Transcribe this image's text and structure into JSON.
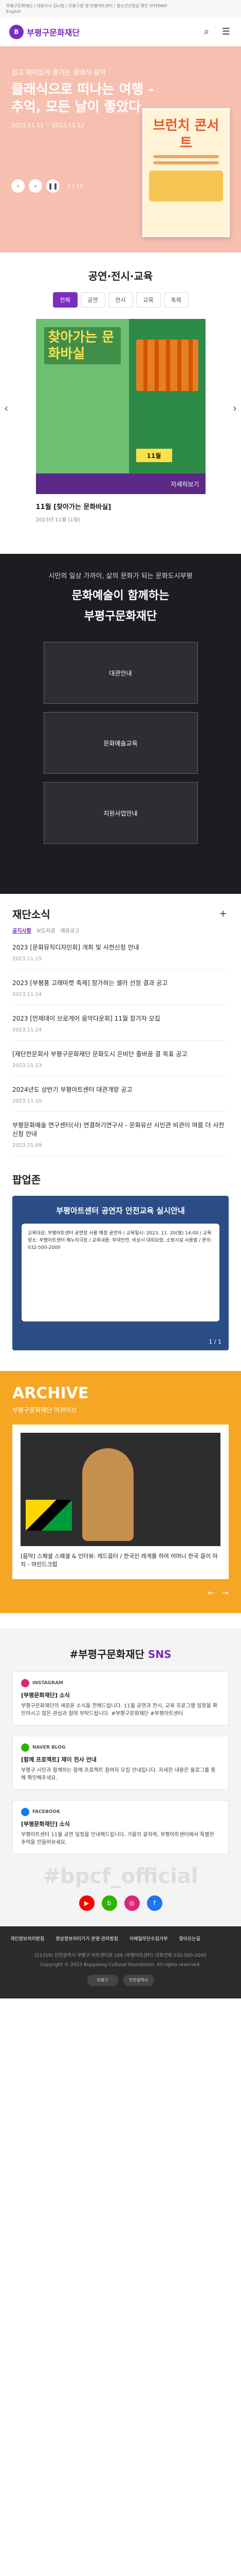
{
  "topbar": {
    "line1": "부평구문화재단 | 대표이사 김나정 | 부평구청 옆 부평아트센터 / 청소년선정성 확인 SITEMAP",
    "line2": "English"
  },
  "header": {
    "logo_text": "부평구문화재단",
    "logo_mark": "B"
  },
  "hero": {
    "sub": "쉽고 재미있게 즐기는 클래식 음악",
    "title": "클래식으로 떠나는 여행 - 추억, 모든 날이 좋았다",
    "date": "2023.11.11 ~ 2023.11.12",
    "counter": "3 / 10",
    "poster_title": "브런치 콘서트"
  },
  "edu": {
    "title": "공연·전시·교육",
    "tabs": [
      "전체",
      "공연",
      "전시",
      "교육",
      "축제"
    ],
    "active_tab": 0,
    "img_big": "찾아가는 문화바실",
    "img_month": "11월",
    "caption": "자세히보기",
    "item_title": "11월 [찾아가는 문화바실]",
    "item_date": "2023년 11월 (1일)"
  },
  "intro": {
    "lead": "시민의 일상 가까이, 삶의 문화가 되는 문화도시부평",
    "line1": "문화예술이 함께하는",
    "line2": "부평구문화재단",
    "cards": [
      "대관안내",
      "문화예술교육",
      "지원사업안내"
    ]
  },
  "news": {
    "title": "재단소식",
    "tabs": [
      "공지사항",
      "보도자료",
      "채용공고"
    ],
    "items": [
      {
        "title": "2023 [문화뮤직디자인회] 개최 및 사전신청 안내",
        "date": "2023.11.15"
      },
      {
        "title": "2023 [부평풍 고래마켓 축제] 참가하는 셀러 선정 결과 공고",
        "date": "2023.11.14"
      },
      {
        "title": "2023 [언제데이 브로게어 음악다운회] 11월 참가자 모집",
        "date": "2023.11.14"
      },
      {
        "title": "[재단전문회사 부평구문화재단 문화도시 은비단 줄바꿈 결 목표 공고",
        "date": "2023.11.13"
      },
      {
        "title": "2024년도 상반기 부평아트센터 대관개방 공고",
        "date": "2023.11.10"
      },
      {
        "title": "부평문화예술 연구센터(사) 연결하기연구사 - 문화유산 시민관 비관이 여름 더 사전신청 안내",
        "date": "2023.11.09"
      }
    ]
  },
  "popup": {
    "title": "팝업존",
    "head": "부평아트센터 공연자 안전교육 실시안내",
    "body": "교육대상: 부평아트센터 공연장 사용 예정 공연자 / 교육일시: 2023. 11. 20(월) 14:00 / 교육장소: 부평아트센터 해누리극장 / 교육내용: 무대안전, 비상시 대피요령, 소방시설 사용법 / 문의: 032-500-2000",
    "counter": "1 / 1"
  },
  "archive": {
    "title": "ARCHIVE",
    "desc": "부평구문화재단 아카이브",
    "item_title": "[음악] 스페셜 스페셜 & 인터뷰: 레드옵터 / 한국인 레게를 하여 어머니 한국 음이 마치 - 마인드크럽",
    "prev": "←",
    "next": "→"
  },
  "sns": {
    "title_prefix": "#부평구문화재단 ",
    "title_accent": "SNS",
    "cards": [
      {
        "platform": "INSTAGRAM",
        "color": "#d62976",
        "title": "[부평문화재단] 소식",
        "text": "부평구문화재단의 새로운 소식을 전해드립니다. 11월 공연과 전시, 교육 프로그램 일정을 확인하시고 많은 관심과 참여 부탁드립니다. #부평구문화재단 #부평아트센터"
      },
      {
        "platform": "NAVER BLOG",
        "color": "#2db400",
        "title": "[함께 프로젝트] 제이 천사 안내",
        "text": "부평구 시민과 함께하는 함께 프로젝트 참여자 모집 안내입니다. 자세한 내용은 블로그를 통해 확인해주세요."
      },
      {
        "platform": "FACEBOOK",
        "color": "#1877f2",
        "title": "[부평문화재단] 소식",
        "text": "부평아트센터 11월 공연 일정을 안내해드립니다. 가을의 끝자락, 부평아트센터에서 특별한 추억을 만들어보세요."
      }
    ],
    "watermark": "#bpcf_official",
    "icons": [
      {
        "name": "youtube",
        "label": "▶",
        "color": "#ff0000"
      },
      {
        "name": "blog",
        "label": "b",
        "color": "#2db400"
      },
      {
        "name": "instagram",
        "label": "◎",
        "color": "#d62976"
      },
      {
        "name": "facebook",
        "label": "f",
        "color": "#1877f2"
      }
    ]
  },
  "footer": {
    "nav": [
      "개인정보처리방침",
      "영상정보처리기기 운영·관리방침",
      "이메일무단수집거부",
      "찾아오는길"
    ],
    "address": "(21316) 인천광역시 부평구 아트센터로 166 (부평아트센터) 대표전화 032-500-2000",
    "copyright": "Copyright © 2023 Bupyeong Cultural Foundation. All rights reserved.",
    "badges": [
      "부평구",
      "인천광역시"
    ]
  }
}
